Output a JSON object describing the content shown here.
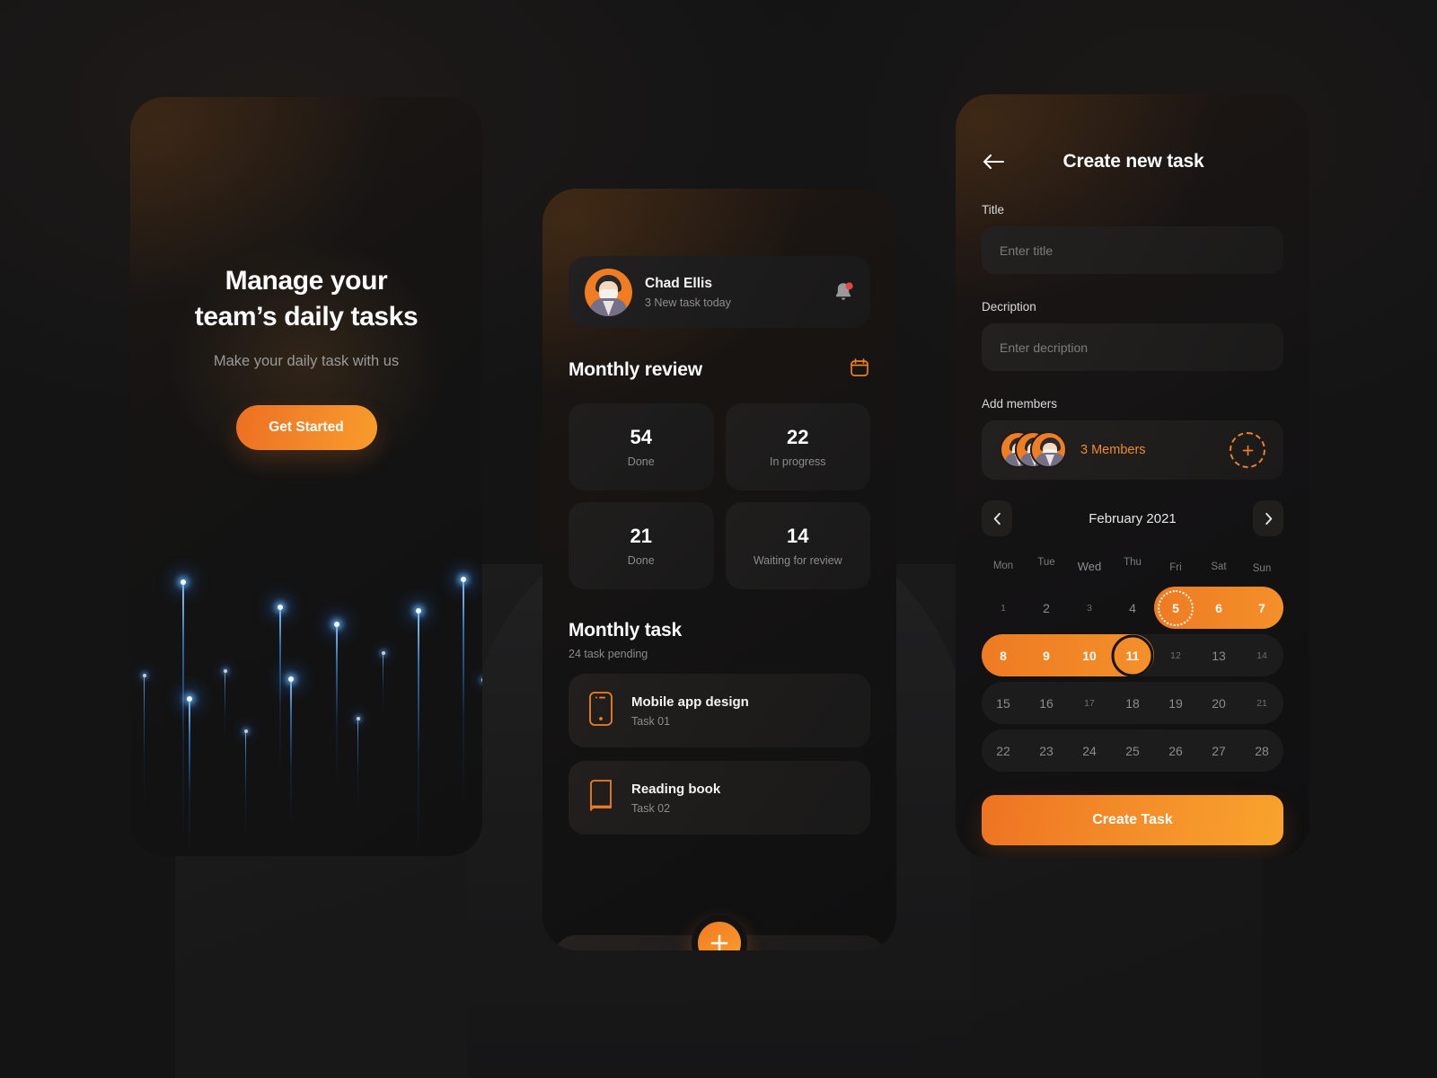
{
  "onboarding": {
    "title_line1": "Manage your",
    "title_line2": "team’s daily tasks",
    "subtitle": "Make your daily task with us",
    "cta_label": "Get Started"
  },
  "home": {
    "user": {
      "name": "Chad Ellis",
      "status": "3 New task today",
      "avatar_icon": "user-avatar",
      "bell_icon": "notification-bell-icon",
      "has_notification_badge": true
    },
    "review": {
      "title": "Monthly review",
      "calendar_icon": "calendar-icon",
      "stats": [
        {
          "value": "54",
          "label": "Done"
        },
        {
          "value": "22",
          "label": "In progress"
        },
        {
          "value": "21",
          "label": "Done"
        },
        {
          "value": "14",
          "label": "Waiting for review"
        }
      ]
    },
    "tasks": {
      "title": "Monthly task",
      "subtitle": "24 task pending",
      "items": [
        {
          "name": "Mobile app design",
          "id": "Task 01",
          "icon": "mobile-phone-icon"
        },
        {
          "name": "Reading book",
          "id": "Task 02",
          "icon": "book-icon"
        }
      ]
    },
    "nav": {
      "home_icon": "home-icon",
      "calendar_icon": "calendar-icon",
      "fab_icon": "plus-icon"
    }
  },
  "create_task": {
    "back_icon": "arrow-left-icon",
    "title": "Create new task",
    "fields": [
      {
        "label": "Title",
        "placeholder": "Enter title",
        "value": ""
      },
      {
        "label": "Decription",
        "placeholder": "Enter decription",
        "value": ""
      }
    ],
    "members": {
      "label": "Add members",
      "count_text": "3 Members",
      "add_icon": "plus-icon",
      "avatar_icon": "user-avatar"
    },
    "calendar": {
      "prev_icon": "chevron-left-icon",
      "next_icon": "chevron-right-icon",
      "month": "February 2021",
      "weekdays": [
        "Mon",
        "Tue",
        "Wed",
        "Thu",
        "Fri",
        "Sat",
        "Sun"
      ],
      "weeks": [
        [
          "1",
          "2",
          "3",
          "4",
          "5",
          "6",
          "7"
        ],
        [
          "8",
          "9",
          "10",
          "11",
          "12",
          "13",
          "14"
        ],
        [
          "15",
          "16",
          "17",
          "18",
          "19",
          "20",
          "21"
        ],
        [
          "22",
          "23",
          "24",
          "25",
          "26",
          "27",
          "28"
        ]
      ],
      "range_start": "5",
      "range_end": "11",
      "selected_day": "11"
    },
    "submit_label": "Create Task"
  },
  "colors": {
    "accent_orange": "#EE7B22",
    "accent_orange_light": "#F9A32D",
    "background": "#141415",
    "card": "#1D1C1C",
    "text_primary": "#FAFAFA",
    "text_muted": "#8B8B8B",
    "ray_blue": "#388CE6",
    "badge_red": "#E8453C"
  }
}
